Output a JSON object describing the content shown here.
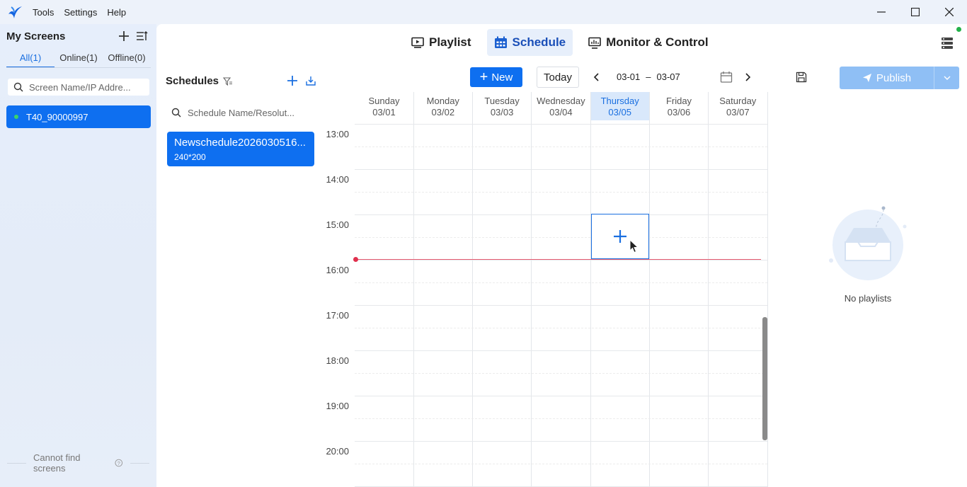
{
  "menu": {
    "items": [
      "Tools",
      "Settings",
      "Help"
    ]
  },
  "left_panel": {
    "title": "My Screens",
    "tabs": [
      {
        "label": "All(1)",
        "active": true
      },
      {
        "label": "Online(1)",
        "active": false
      },
      {
        "label": "Offline(0)",
        "active": false
      }
    ],
    "search_placeholder": "Screen Name/IP Addre...",
    "screens": [
      {
        "name": "T40_90000997",
        "online": true
      }
    ],
    "footer": "Cannot find screens"
  },
  "nav": {
    "tabs": [
      {
        "label": "Playlist",
        "active": false,
        "icon": "playlist-icon"
      },
      {
        "label": "Schedule",
        "active": true,
        "icon": "calendar-icon"
      },
      {
        "label": "Monitor & Control",
        "active": false,
        "icon": "monitor-icon"
      }
    ]
  },
  "schedules": {
    "title": "Schedules",
    "search_placeholder": "Schedule Name/Resolut...",
    "items": [
      {
        "name": "Newschedule2026030516...",
        "resolution": "240*200"
      }
    ]
  },
  "toolbar": {
    "new_label": "New",
    "today_label": "Today",
    "range_start": "03-01",
    "range_sep": "–",
    "range_end": "03-07",
    "publish_label": "Publish"
  },
  "calendar": {
    "days": [
      {
        "name": "Sunday",
        "date": "03/01",
        "today": false
      },
      {
        "name": "Monday",
        "date": "03/02",
        "today": false
      },
      {
        "name": "Tuesday",
        "date": "03/03",
        "today": false
      },
      {
        "name": "Wednesday",
        "date": "03/04",
        "today": false
      },
      {
        "name": "Thursday",
        "date": "03/05",
        "today": true
      },
      {
        "name": "Friday",
        "date": "03/06",
        "today": false
      },
      {
        "name": "Saturday",
        "date": "03/07",
        "today": false
      }
    ],
    "hours": [
      "13:00",
      "14:00",
      "15:00",
      "16:00",
      "17:00",
      "18:00",
      "19:00",
      "20:00"
    ]
  },
  "playlists": {
    "empty_text": "No playlists"
  },
  "colors": {
    "accent": "#0e6ff0",
    "online": "#3ad36b",
    "now_line": "#e65a70",
    "publish_disabled": "#8fbff5"
  }
}
